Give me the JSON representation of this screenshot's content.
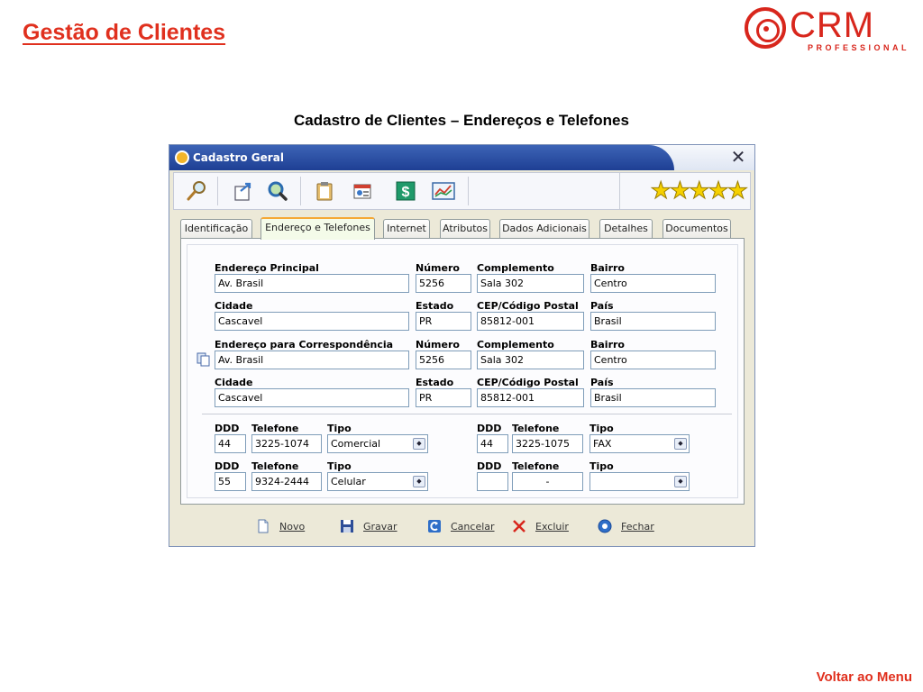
{
  "slide": {
    "title": "Gestão de Clientes",
    "subtitle": "Cadastro de Clientes – Endereços e Telefones",
    "footer_link": "Voltar ao Menu",
    "logo_text": "CRM",
    "logo_subtext": "PROFESSIONAL"
  },
  "colors": {
    "accent": "#e0301e",
    "titlebar": "#2a4ea3",
    "stars": "#f5d000"
  },
  "window": {
    "title": "Cadastro Geral",
    "close": "✕"
  },
  "toolbar": {
    "icons": [
      "search-icon",
      "export-icon",
      "zoom-icon",
      "clipboard-icon",
      "address-book-icon",
      "money-icon",
      "chart-icon"
    ],
    "rating_stars": 5
  },
  "tabs": [
    {
      "label": "Identificação"
    },
    {
      "label": "Endereço e Telefones"
    },
    {
      "label": "Internet"
    },
    {
      "label": "Atributos"
    },
    {
      "label": "Dados Adicionais"
    },
    {
      "label": "Detalhes"
    },
    {
      "label": "Documentos"
    }
  ],
  "address_main": {
    "labels": {
      "endereco": "Endereço Principal",
      "numero": "Número",
      "complemento": "Complemento",
      "bairro": "Bairro",
      "cidade": "Cidade",
      "estado": "Estado",
      "cep": "CEP/Código Postal",
      "pais": "País"
    },
    "endereco": "Av. Brasil",
    "numero": "5256",
    "complemento": "Sala 302",
    "bairro": "Centro",
    "cidade": "Cascavel",
    "estado": "PR",
    "cep": "85812-001",
    "pais": "Brasil"
  },
  "address_mail": {
    "labels": {
      "endereco": "Endereço para Correspondência",
      "numero": "Número",
      "complemento": "Complemento",
      "bairro": "Bairro",
      "cidade": "Cidade",
      "estado": "Estado",
      "cep": "CEP/Código Postal",
      "pais": "País"
    },
    "endereco": "Av. Brasil",
    "numero": "5256",
    "complemento": "Sala 302",
    "bairro": "Centro",
    "cidade": "Cascavel",
    "estado": "PR",
    "cep": "85812-001",
    "pais": "Brasil"
  },
  "phones": {
    "labels": {
      "ddd": "DDD",
      "telefone": "Telefone",
      "tipo": "Tipo"
    },
    "p1": {
      "ddd": "44",
      "telefone": "3225-1074",
      "tipo": "Comercial"
    },
    "p2": {
      "ddd": "44",
      "telefone": "3225-1075",
      "tipo": "FAX"
    },
    "p3": {
      "ddd": "55",
      "telefone": "9324-2444",
      "tipo": "Celular"
    },
    "p4": {
      "ddd": "",
      "telefone": "-",
      "tipo": ""
    }
  },
  "actions": {
    "novo": "Novo",
    "gravar": "Gravar",
    "cancelar": "Cancelar",
    "excluir": "Excluir",
    "fechar": "Fechar"
  }
}
